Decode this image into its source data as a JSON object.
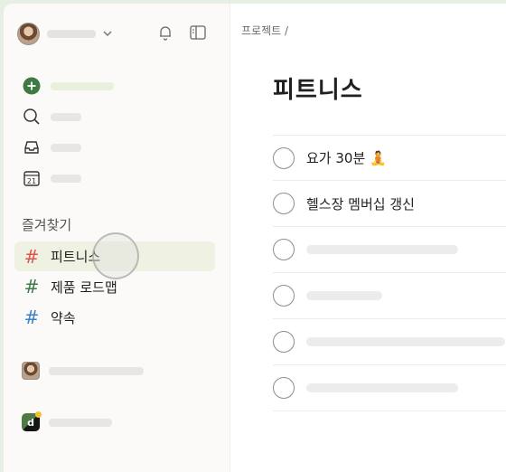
{
  "sidebar": {
    "favorites_title": "즐겨찾기",
    "favorites": [
      {
        "label": "피트니스",
        "hash_color": "#e0534a",
        "active": true
      },
      {
        "label": "제품 로드맵",
        "hash_color": "#3f7a45",
        "active": false
      },
      {
        "label": "약속",
        "hash_color": "#3b82c4",
        "active": false
      }
    ],
    "nav_icons": [
      "add-task-icon",
      "search-icon",
      "inbox-icon",
      "calendar-today-icon"
    ],
    "calendar_day": "21",
    "team_badge_letter": "d"
  },
  "main": {
    "breadcrumb": "프로젝트 /",
    "title": "피트니스",
    "tasks": [
      {
        "text": "요가 30분 🧘"
      },
      {
        "text": "헬스장 멤버십 갱신"
      }
    ]
  },
  "colors": {
    "accent_green": "#3f7a45",
    "sidebar_bg": "#fbfaf8",
    "active_bg": "#eff2e3"
  }
}
